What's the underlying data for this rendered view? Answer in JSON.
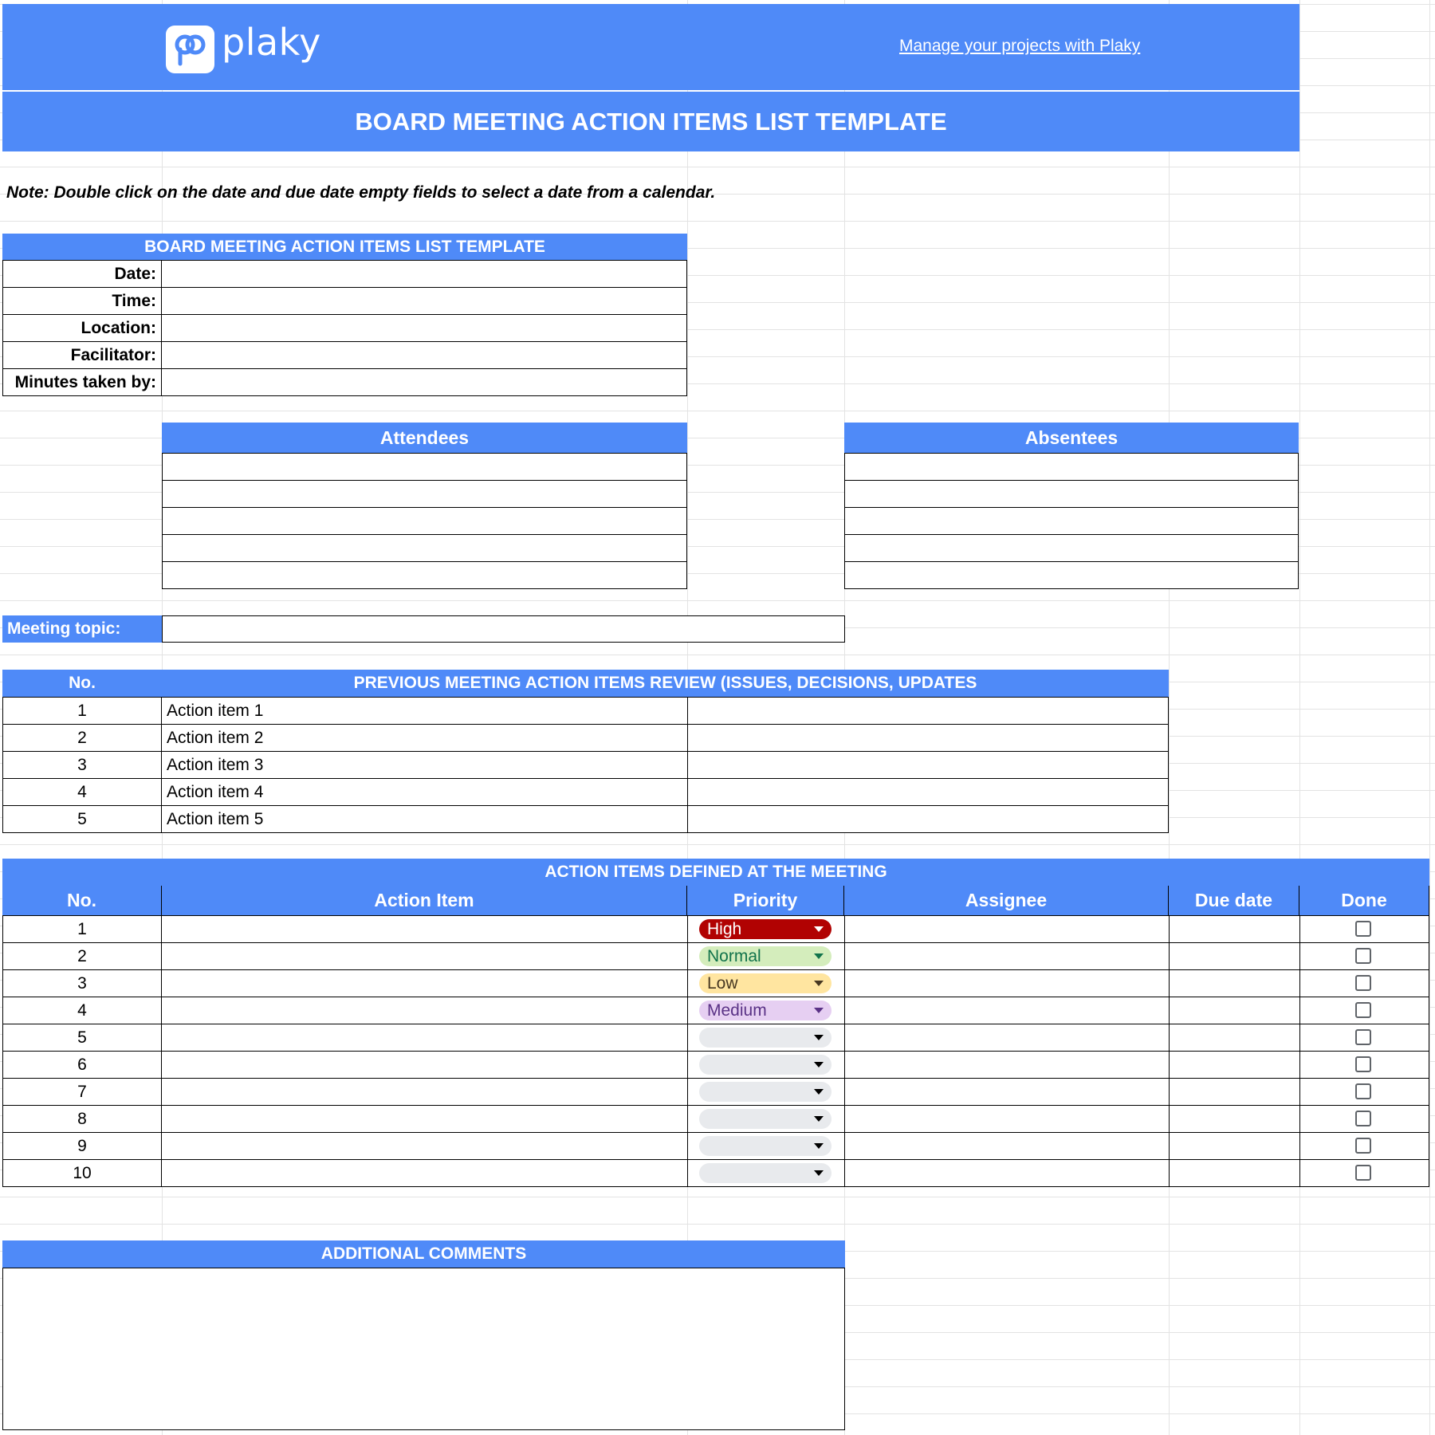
{
  "header": {
    "logo_icon": "plaky-logo-icon",
    "logo_text": "plaky",
    "link_text": "Manage your projects with Plaky",
    "title": "BOARD MEETING ACTION ITEMS LIST TEMPLATE"
  },
  "colors": {
    "accent": "#4f8af8"
  },
  "note": "Note: Double click on the date and due date empty fields to select a date from a calendar.",
  "info_table": {
    "title": "BOARD MEETING ACTION ITEMS LIST TEMPLATE",
    "rows": [
      {
        "label": "Date:",
        "value": ""
      },
      {
        "label": "Time:",
        "value": ""
      },
      {
        "label": "Location:",
        "value": ""
      },
      {
        "label": "Facilitator:",
        "value": ""
      },
      {
        "label": "Minutes taken by:",
        "value": ""
      }
    ]
  },
  "attendees": {
    "header": "Attendees",
    "rows": [
      "",
      "",
      "",
      "",
      ""
    ]
  },
  "absentees": {
    "header": "Absentees",
    "rows": [
      "",
      "",
      "",
      "",
      ""
    ]
  },
  "meeting_topic": {
    "label": "Meeting topic:",
    "value": ""
  },
  "previous_review": {
    "no_header": "No.",
    "header": "PREVIOUS MEETING ACTION ITEMS REVIEW (ISSUES, DECISIONS, UPDATES",
    "rows": [
      {
        "no": "1",
        "item": "Action item 1",
        "details": ""
      },
      {
        "no": "2",
        "item": "Action item 2",
        "details": ""
      },
      {
        "no": "3",
        "item": "Action item 3",
        "details": ""
      },
      {
        "no": "4",
        "item": "Action item 4",
        "details": ""
      },
      {
        "no": "5",
        "item": "Action item 5",
        "details": ""
      }
    ]
  },
  "action_items": {
    "title": "ACTION ITEMS DEFINED AT THE MEETING",
    "columns": [
      "No.",
      "Action Item",
      "Priority",
      "Assignee",
      "Due date",
      "Done"
    ],
    "rows": [
      {
        "no": "1",
        "item": "",
        "priority": "High",
        "priority_bg": "#b10202",
        "priority_fg": "#ffffff",
        "assignee": "",
        "due": "",
        "done": false
      },
      {
        "no": "2",
        "item": "",
        "priority": "Normal",
        "priority_bg": "#d4edbc",
        "priority_fg": "#11734b",
        "assignee": "",
        "due": "",
        "done": false
      },
      {
        "no": "3",
        "item": "",
        "priority": "Low",
        "priority_bg": "#ffe5a0",
        "priority_fg": "#473821",
        "assignee": "",
        "due": "",
        "done": false
      },
      {
        "no": "4",
        "item": "",
        "priority": "Medium",
        "priority_bg": "#e6cff2",
        "priority_fg": "#5a3286",
        "assignee": "",
        "due": "",
        "done": false
      },
      {
        "no": "5",
        "item": "",
        "priority": "",
        "priority_bg": "#e8eaed",
        "priority_fg": "#000000",
        "assignee": "",
        "due": "",
        "done": false
      },
      {
        "no": "6",
        "item": "",
        "priority": "",
        "priority_bg": "#e8eaed",
        "priority_fg": "#000000",
        "assignee": "",
        "due": "",
        "done": false
      },
      {
        "no": "7",
        "item": "",
        "priority": "",
        "priority_bg": "#e8eaed",
        "priority_fg": "#000000",
        "assignee": "",
        "due": "",
        "done": false
      },
      {
        "no": "8",
        "item": "",
        "priority": "",
        "priority_bg": "#e8eaed",
        "priority_fg": "#000000",
        "assignee": "",
        "due": "",
        "done": false
      },
      {
        "no": "9",
        "item": "",
        "priority": "",
        "priority_bg": "#e8eaed",
        "priority_fg": "#000000",
        "assignee": "",
        "due": "",
        "done": false
      },
      {
        "no": "10",
        "item": "",
        "priority": "",
        "priority_bg": "#e8eaed",
        "priority_fg": "#000000",
        "assignee": "",
        "due": "",
        "done": false
      }
    ]
  },
  "additional_comments": {
    "header": "ADDITIONAL COMMENTS",
    "value": ""
  }
}
